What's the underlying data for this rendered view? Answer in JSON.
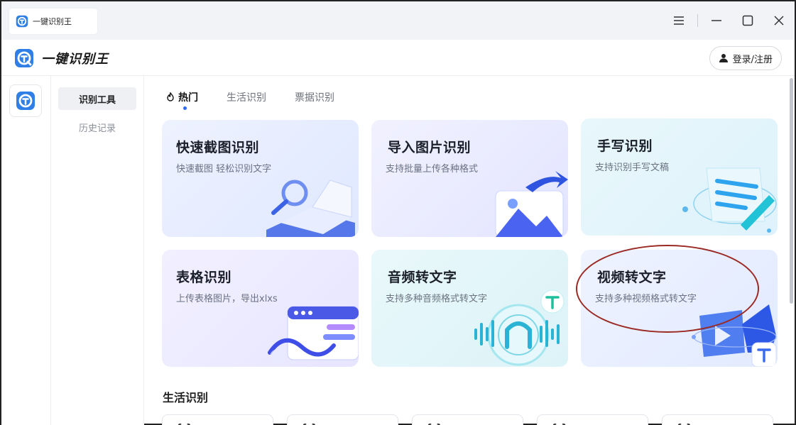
{
  "window": {
    "tab_title": "一键识别王",
    "controls": {
      "menu": "☰",
      "minimize": "—",
      "maximize": "☐",
      "close": "✕"
    }
  },
  "header": {
    "brand_name": "一键识别王",
    "login_label": "登录/注册"
  },
  "subnav": {
    "items": [
      {
        "label": "识别工具",
        "active": true
      },
      {
        "label": "历史记录",
        "active": false
      }
    ]
  },
  "tabs": [
    {
      "label": "热门",
      "active": true
    },
    {
      "label": "生活识别",
      "active": false
    },
    {
      "label": "票据识别",
      "active": false
    }
  ],
  "cards": [
    {
      "title": "快速截图识别",
      "subtitle": "快速截图 轻松识别文字"
    },
    {
      "title": "导入图片识别",
      "subtitle": "支持批量上传各种格式"
    },
    {
      "title": "手写识别",
      "subtitle": "支持识别手写文稿"
    },
    {
      "title": "表格识别",
      "subtitle": "上传表格图片，导出xlxs"
    },
    {
      "title": "音频转文字",
      "subtitle": "支持多种音频格式转文字"
    },
    {
      "title": "视频转文字",
      "subtitle": "支持多种视频格式转文字"
    }
  ],
  "section": {
    "title": "生活识别"
  },
  "colors": {
    "accent": "#2d6bff",
    "annotation": "#9b2a24",
    "logo": "#2f7fe6"
  }
}
